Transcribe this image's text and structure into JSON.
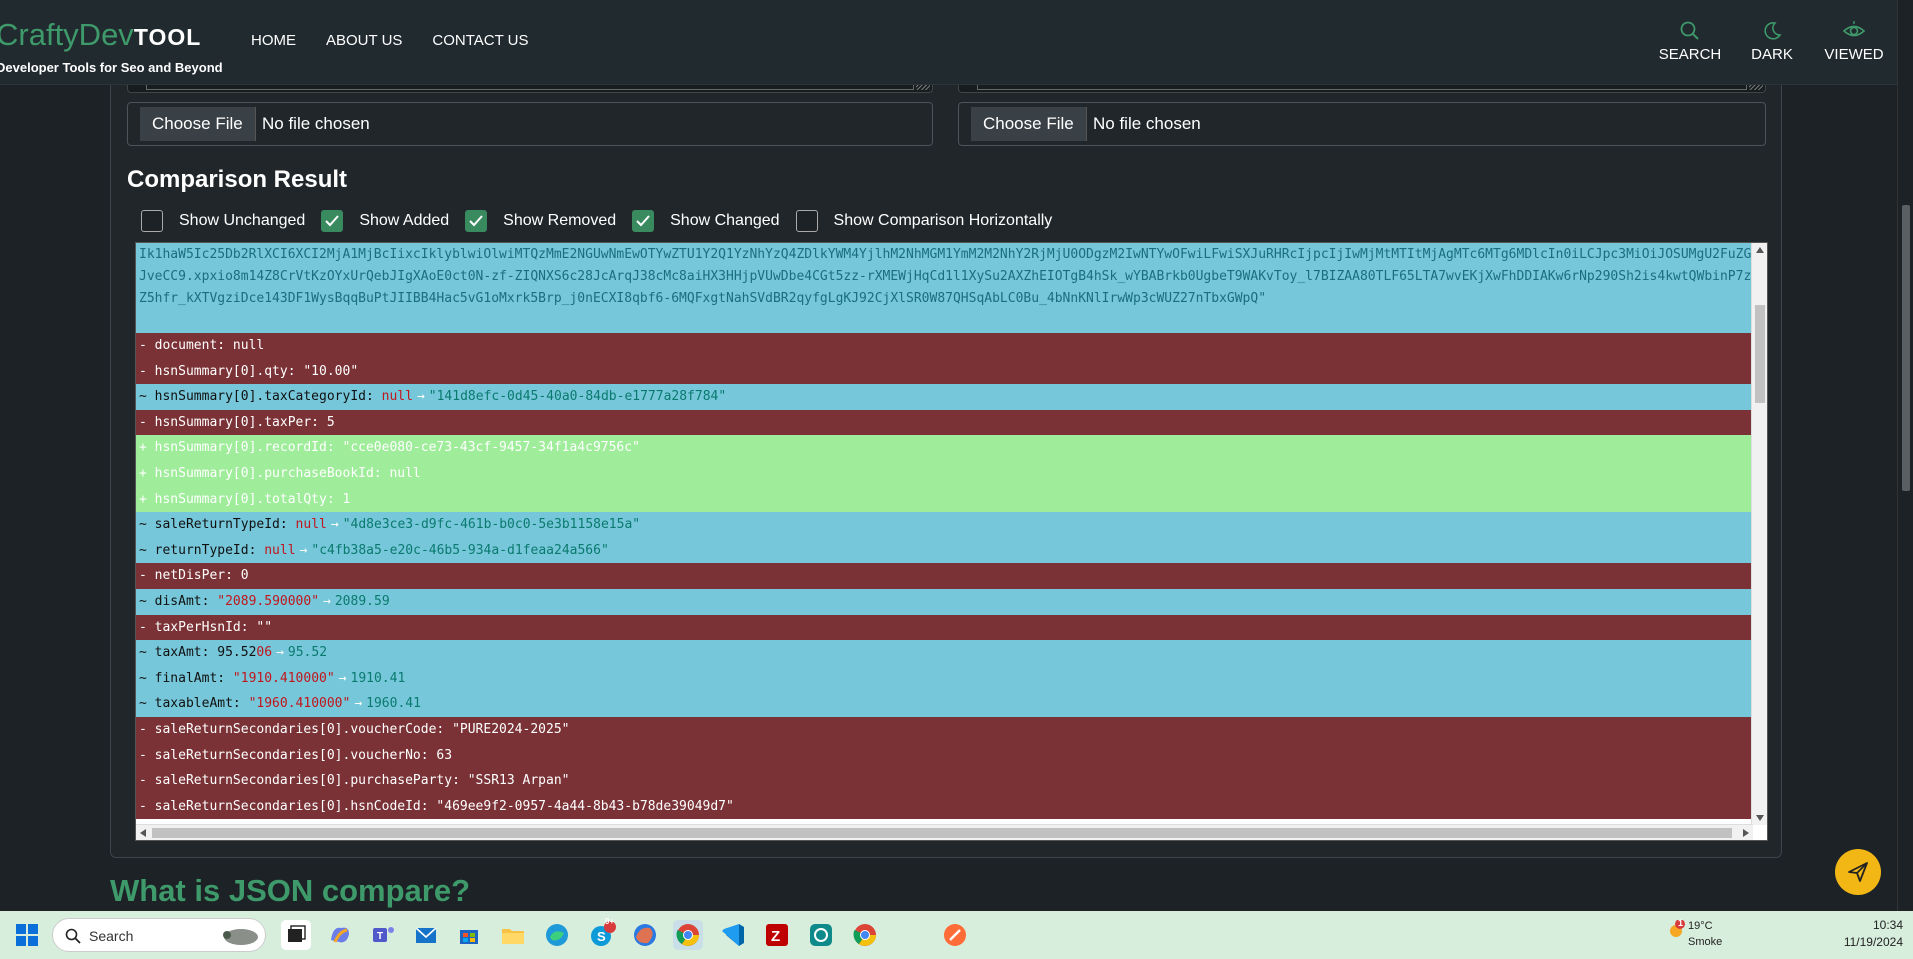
{
  "header": {
    "logo_main": "CraftyDev",
    "logo_tool": "TOOL",
    "logo_sub": "Developer Tools for Seo and Beyond",
    "nav": [
      "HOME",
      "ABOUT US",
      "CONTACT US"
    ],
    "actions": {
      "search": "SEARCH",
      "dark": "DARK",
      "viewed": "VIEWED"
    }
  },
  "files": {
    "left": {
      "button": "Choose File",
      "status": "No file chosen"
    },
    "right": {
      "button": "Choose File",
      "status": "No file chosen"
    }
  },
  "comparison": {
    "title": "Comparison Result",
    "toggles": [
      {
        "label": "Show Unchanged",
        "checked": false
      },
      {
        "label": "Show Added",
        "checked": true
      },
      {
        "label": "Show Removed",
        "checked": true
      },
      {
        "label": "Show Changed",
        "checked": true
      },
      {
        "label": "Show Comparison Horizontally",
        "checked": false
      }
    ]
  },
  "diff": {
    "first_block": "Ik1haW5Ic25Db2RlXCI6XCI2MjA1MjBcIixcIklyblwiOlwiMTQzMmE2NGUwNmEwOTYwZTU1Y2Q1YzNhYzQ4ZDlkYWM4YjlhM2NhMGM1YmM2M2NhY2RjMjU0ODgzM2IwNTYwOFwiLFwiSXJuRHRcIjpcIjIwMjMtMTItMjAgMTc6MTg6MDlcIn0iLCJpc3MiOiJOSUMgU2FuZGJveCC9.xpxio8m14Z8CrVtKzOYxUrQebJIgXAoE0ct0N-zf-ZIQNXS6c28JcArqJ38cMc8aiHX3HHjpVUwDbe4CGt5zz-rXMEWjHqCd1l1XySu2AXZhEIOTgB4hSk_wYBABrkb0UgbeT9WAKvToy_l7BIZAA80TLF65LTA7wvEKjXwFhDDIAKw6rNp290Sh2is4kwtQWbinP7zZ5hfr_kXTVgziDce143DF1WysBqqBuPtJIIBB4Hac5vG1oMxrk5Brp_j0nECXI8qbf6-6MQFxgtNahSVdBR2qyfgLgKJ92CjXlSR0W87QHSqAbLC0Bu_4bNnKNlIrwWp3cWUZ27nTbxGWpQ\"",
    "rows": [
      {
        "type": "removed",
        "text": "- document: null"
      },
      {
        "type": "removed",
        "text": "- hsnSummary[0].qty: \"10.00\""
      },
      {
        "type": "changed",
        "prefix": "~ hsnSummary[0].taxCategoryId: ",
        "old": "null",
        "new": "\"141d8efc-0d45-40a0-84db-e1777a28f784\""
      },
      {
        "type": "removed",
        "text": "- hsnSummary[0].taxPer: 5"
      },
      {
        "type": "added",
        "text": "+ hsnSummary[0].recordId: \"cce0e080-ce73-43cf-9457-34f1a4c9756c\""
      },
      {
        "type": "added",
        "text": "+ hsnSummary[0].purchaseBookId: null"
      },
      {
        "type": "added",
        "text": "+ hsnSummary[0].totalQty: 1"
      },
      {
        "type": "changed",
        "prefix": "~ saleReturnTypeId: ",
        "old": "null",
        "new": "\"4d8e3ce3-d9fc-461b-b0c0-5e3b1158e15a\""
      },
      {
        "type": "changed",
        "prefix": "~ returnTypeId: ",
        "old": "null",
        "new": "\"c4fb38a5-e20c-46b5-934a-d1feaa24a566\""
      },
      {
        "type": "removed",
        "text": "- netDisPer: 0"
      },
      {
        "type": "changed",
        "prefix": "~ disAmt: ",
        "old": "\"2089.590000\"",
        "new": "2089.59"
      },
      {
        "type": "removed",
        "text": "- taxPerHsnId: \"\""
      },
      {
        "type": "changed",
        "prefix": "~ taxAmt: 95.52",
        "old": "06",
        "new": "95.52"
      },
      {
        "type": "changed",
        "prefix": "~ finalAmt: ",
        "old": "\"1910.410000\"",
        "new": "1910.41"
      },
      {
        "type": "changed",
        "prefix": "~ taxableAmt: ",
        "old": "\"1960.410000\"",
        "new": "1960.41"
      },
      {
        "type": "removed",
        "text": "- saleReturnSecondaries[0].voucherCode: \"PURE2024-2025\""
      },
      {
        "type": "removed",
        "text": "- saleReturnSecondaries[0].voucherNo: 63"
      },
      {
        "type": "removed",
        "text": "- saleReturnSecondaries[0].purchaseParty: \"SSR13 Arpan\""
      },
      {
        "type": "removed",
        "text": "- saleReturnSecondaries[0].hsnCodeId: \"469ee9f2-0957-4a44-8b43-b78de39049d7\""
      }
    ]
  },
  "footer_heading": "What is JSON compare?",
  "taskbar": {
    "search_label": "Search",
    "weather_temp": "19°C",
    "weather_desc": "Smoke",
    "weather_badge": "1",
    "time": "10:34",
    "date": "11/19/2024",
    "notification_badge": "9+"
  },
  "colors": {
    "brand_green": "#3e9a6a",
    "changed_bg": "#76c7da",
    "removed_bg": "#7a3236",
    "added_bg": "#9fed9a",
    "fab": "#f3b715"
  }
}
